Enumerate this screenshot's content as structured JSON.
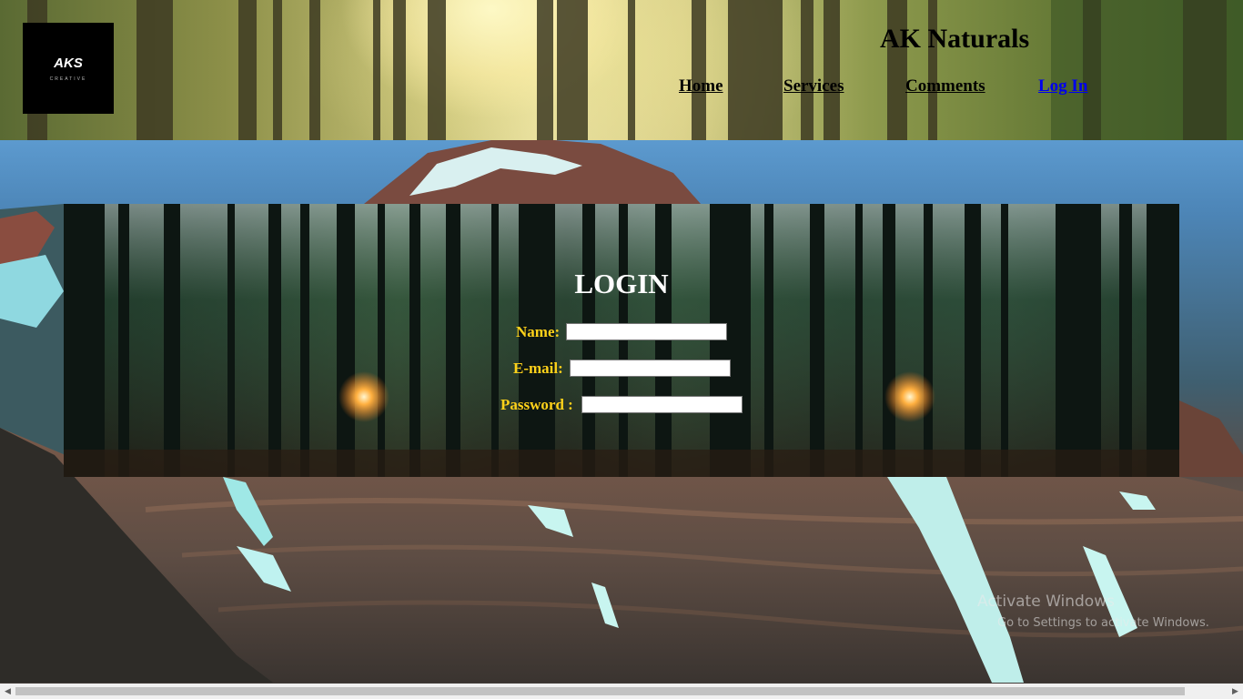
{
  "header": {
    "logo": {
      "mark": "AKS",
      "sub": "CREATIVE"
    },
    "title": "AK Naturals",
    "nav": [
      {
        "label": "Home",
        "active": false
      },
      {
        "label": "Services",
        "active": false
      },
      {
        "label": "Comments",
        "active": false
      },
      {
        "label": "Log In",
        "active": true
      }
    ]
  },
  "login": {
    "title": "LOGIN",
    "fields": [
      {
        "label": "Name:",
        "value": ""
      },
      {
        "label": "E-mail:",
        "value": ""
      },
      {
        "label": "Password :",
        "value": ""
      }
    ]
  },
  "watermark": {
    "title": "Activate Windows",
    "subtitle": "Go to Settings to activate Windows."
  },
  "colors": {
    "label_color": "#ffd21a",
    "active_link": "#0000ee"
  }
}
